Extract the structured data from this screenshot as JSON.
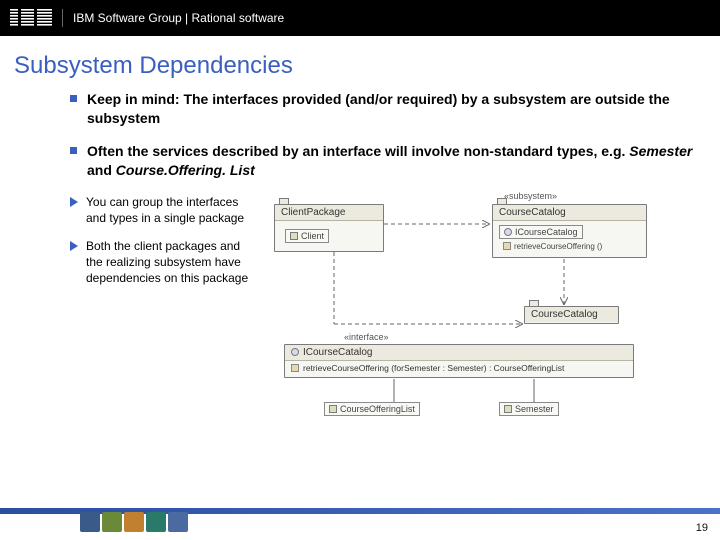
{
  "header": {
    "breadcrumb": "IBM Software Group | Rational software"
  },
  "title": "Subsystem Dependencies",
  "bullets": [
    {
      "pre": "Keep in mind: The interfaces provided (and/or required) by a subsystem are ",
      "bold": "outside",
      "post": " the subsystem"
    },
    {
      "pre": "Often the services described by an interface will involve non-standard types, e.g. ",
      "it1": "Semester",
      "mid": " and ",
      "it2": "Course.Offering. List"
    }
  ],
  "sub_bullets": [
    "You can group the interfaces and types in a single package",
    "Both the client packages and the realizing subsystem have dependencies on this package"
  ],
  "diagram": {
    "client_package": "ClientPackage",
    "client": "Client",
    "course_catalog_pkg": "CourseCatalog",
    "subsystem_stereo": "«subsystem»",
    "icourse_catalog": "ICourseCatalog",
    "method_sig": "retrieveCourseOffering ()",
    "interface_stereo": "«interface»",
    "op_sig": "retrieveCourseOffering (forSemester : Semester) : CourseOfferingList",
    "course_offering_list": "CourseOfferingList",
    "semester": "Semester"
  },
  "page": "19"
}
